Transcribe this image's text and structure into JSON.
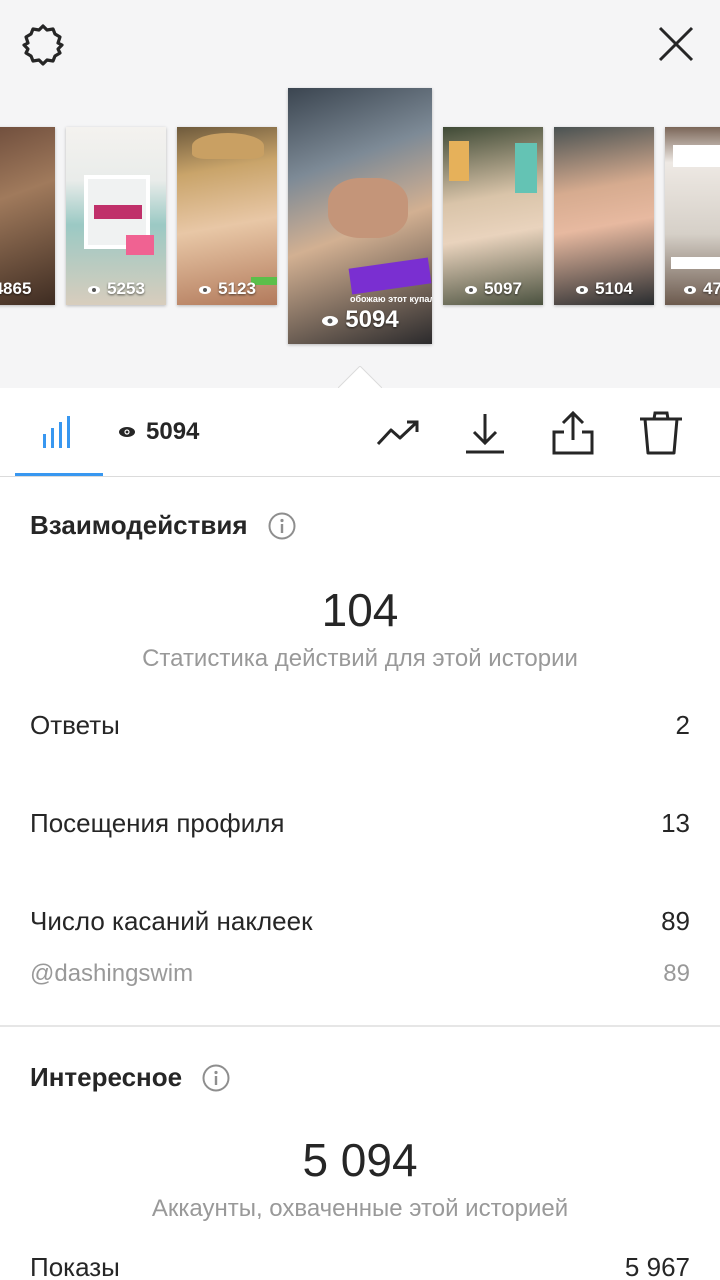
{
  "header": {
    "settings_icon": "gear-icon",
    "close_icon": "close-icon"
  },
  "stories": [
    {
      "views": "4865"
    },
    {
      "views": "5253"
    },
    {
      "views": "5123"
    },
    {
      "views": "5094",
      "selected": true
    },
    {
      "views": "5097"
    },
    {
      "views": "5104"
    },
    {
      "views": "47"
    }
  ],
  "selected_story": {
    "sticker_text": "обожаю этот купальник",
    "mention": "@DASHINGSWIM"
  },
  "toolbar": {
    "view_count": "5094",
    "icons": [
      "bar-chart-icon",
      "eye-icon",
      "trend-icon",
      "download-icon",
      "share-icon",
      "trash-icon"
    ]
  },
  "interactions": {
    "title": "Взаимодействия",
    "total": "104",
    "caption": "Статистика действий для этой истории",
    "rows": [
      {
        "label": "Ответы",
        "value": "2"
      },
      {
        "label": "Посещения профиля",
        "value": "13"
      },
      {
        "label": "Число касаний наклеек",
        "value": "89"
      }
    ],
    "sub_row": {
      "label": "@dashingswim",
      "value": "89"
    }
  },
  "discovery": {
    "title": "Интересное",
    "total": "5 094",
    "caption": "Аккаунты, охваченные этой историей",
    "rows": [
      {
        "label": "Показы",
        "value": "5 967"
      }
    ]
  },
  "colors": {
    "accent": "#3897f0",
    "text": "#262626",
    "muted": "#999999"
  }
}
